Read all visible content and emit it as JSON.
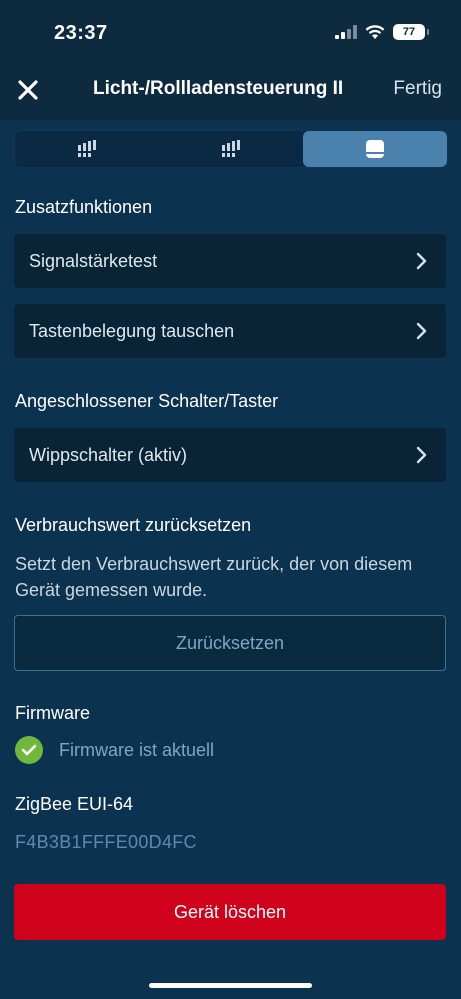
{
  "status_bar": {
    "time": "23:37",
    "battery": "77"
  },
  "nav": {
    "title": "Licht-/Rollladensteuerung II",
    "done_label": "Fertig"
  },
  "tabs": [
    {
      "icon": "device-icon-1",
      "active": false
    },
    {
      "icon": "device-icon-2",
      "active": false
    },
    {
      "icon": "device-settings-icon",
      "active": true
    }
  ],
  "extras": {
    "heading": "Zusatzfunktionen",
    "items": [
      {
        "label": "Signalstärketest"
      },
      {
        "label": "Tastenbelegung tauschen"
      }
    ]
  },
  "switch": {
    "heading": "Angeschlossener Schalter/Taster",
    "value": "Wippschalter (aktiv)"
  },
  "consumption": {
    "heading": "Verbrauchswert zurücksetzen",
    "description": "Setzt den Verbrauchswert zurück, der von diesem Gerät gemessen wurde.",
    "button_label": "Zurücksetzen"
  },
  "firmware": {
    "heading": "Firmware",
    "status": "Firmware ist aktuell",
    "status_color": "#6fb83b"
  },
  "zigbee": {
    "heading": "ZigBee EUI-64",
    "value": "F4B3B1FFFE00D4FC"
  },
  "delete": {
    "label": "Gerät löschen",
    "color": "#d0021b"
  }
}
